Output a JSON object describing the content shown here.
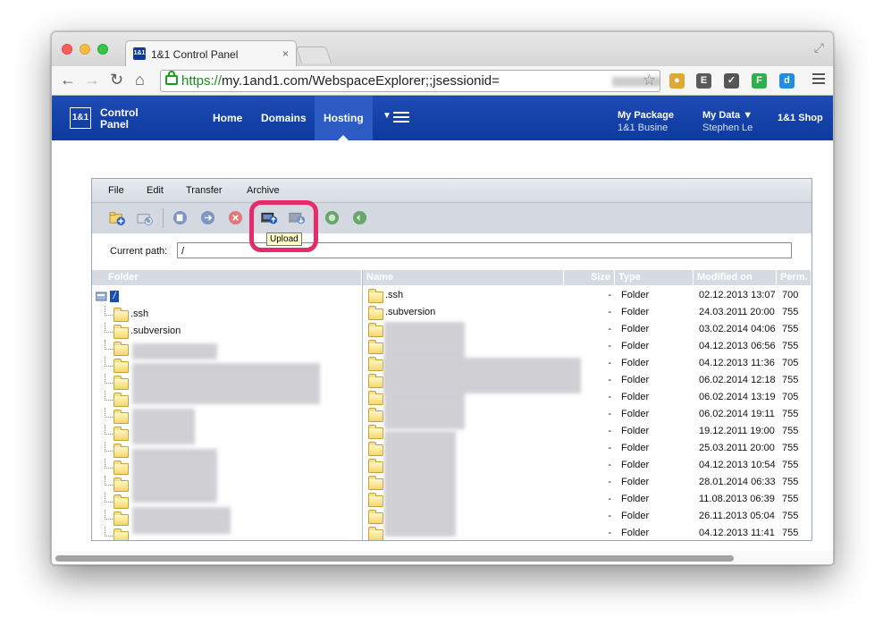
{
  "browser": {
    "tab_title": "1&1 Control Panel",
    "favicon_text": "1&1",
    "tab_close": "×",
    "url_scheme": "https://",
    "url_rest": "my.1and1.com/WebspaceExplorer;;jsessionid=",
    "nav": {
      "back": "←",
      "forward": "→",
      "reload": "↻",
      "home": "⌂"
    },
    "star": "☆",
    "fullscreen": "⤢",
    "extensions": [
      {
        "name": "cookie-icon",
        "color": "#e0a83a",
        "text": "●"
      },
      {
        "name": "evernote-icon",
        "color": "#5a5a5a",
        "text": "E"
      },
      {
        "name": "pocket-icon",
        "color": "#555555",
        "text": "✓"
      },
      {
        "name": "feedly-icon",
        "color": "#2bb24c",
        "text": "F"
      },
      {
        "name": "diigo-icon",
        "color": "#1e8fe1",
        "text": "d"
      }
    ]
  },
  "header": {
    "logo": "1&1",
    "logo_line1": "Control",
    "logo_line2": "Panel",
    "nav": [
      "Home",
      "Domains",
      "Hosting"
    ],
    "active_nav": "Hosting",
    "more_arrow": "▼",
    "package_title": "My Package",
    "package_sub": "1&1 Busine",
    "data_title": "My Data ▼",
    "data_sub": "Stephen Le",
    "shop": "1&1 Shop",
    "brand_color": "#0c3a9d"
  },
  "explorer": {
    "menu": [
      "File",
      "Edit",
      "Transfer",
      "Archive"
    ],
    "tooltip": "Upload",
    "path_label": "Current path:",
    "path_value": "/",
    "folder_header": "Folder",
    "root_label": "/",
    "tree": [
      ".ssh",
      ".subversion"
    ],
    "columns": {
      "name": "Name",
      "size": "Size",
      "type": "Type",
      "modified": "Modified on",
      "perm": "Perm."
    },
    "files": [
      {
        "name": ".ssh",
        "size": "-",
        "type": "Folder",
        "modified": "02.12.2013 13:07",
        "perm": "700"
      },
      {
        "name": ".subversion",
        "size": "-",
        "type": "Folder",
        "modified": "24.03.2011 20:00",
        "perm": "755"
      },
      {
        "name": "",
        "size": "-",
        "type": "Folder",
        "modified": "03.02.2014 04:06",
        "perm": "755"
      },
      {
        "name": "",
        "size": "-",
        "type": "Folder",
        "modified": "04.12.2013 06:56",
        "perm": "755"
      },
      {
        "name": "",
        "size": "-",
        "type": "Folder",
        "modified": "04.12.2013 11:36",
        "perm": "705"
      },
      {
        "name": "",
        "size": "-",
        "type": "Folder",
        "modified": "06.02.2014 12:18",
        "perm": "755"
      },
      {
        "name": "",
        "size": "-",
        "type": "Folder",
        "modified": "06.02.2014 13:19",
        "perm": "705"
      },
      {
        "name": "",
        "size": "-",
        "type": "Folder",
        "modified": "06.02.2014 19:11",
        "perm": "755"
      },
      {
        "name": "",
        "size": "-",
        "type": "Folder",
        "modified": "19.12.2011 19:00",
        "perm": "755"
      },
      {
        "name": "",
        "size": "-",
        "type": "Folder",
        "modified": "25.03.2011 20:00",
        "perm": "755"
      },
      {
        "name": "",
        "size": "-",
        "type": "Folder",
        "modified": "04.12.2013 10:54",
        "perm": "755"
      },
      {
        "name": "",
        "size": "-",
        "type": "Folder",
        "modified": "28.01.2014 06:33",
        "perm": "755"
      },
      {
        "name": "",
        "size": "-",
        "type": "Folder",
        "modified": "11.08.2013 06:39",
        "perm": "755"
      },
      {
        "name": "",
        "size": "-",
        "type": "Folder",
        "modified": "26.11.2013 05:04",
        "perm": "755"
      },
      {
        "name": "",
        "size": "-",
        "type": "Folder",
        "modified": "04.12.2013 11:41",
        "perm": "755"
      }
    ]
  }
}
